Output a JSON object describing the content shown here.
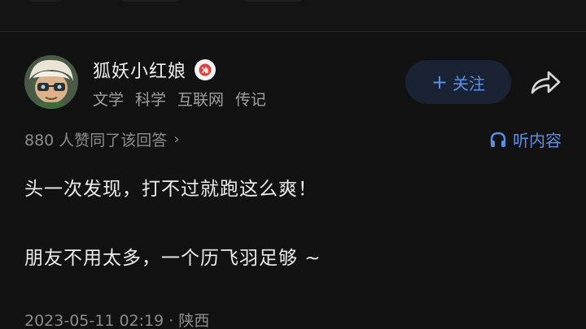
{
  "author": {
    "name": "狐妖小红娘",
    "tags": [
      "文学",
      "科学",
      "互联网",
      "传记"
    ],
    "badge_icon": "honor-badge-icon",
    "avatar_icon": "user-avatar"
  },
  "actions": {
    "follow_plus": "+",
    "follow_label": "关注",
    "share_icon": "share-arrow-icon"
  },
  "meta": {
    "vote_summary": "880 人赞同了该回答",
    "vote_chevron": "›",
    "listen_label": "听内容",
    "listen_icon": "headphones-icon"
  },
  "answer": {
    "paragraphs": [
      "头一次发现，打不过就跑这么爽！",
      "朋友不用太多，一个历飞羽足够 ~"
    ]
  },
  "post": {
    "time_location": "2023-05-11 02:19 · 陕西"
  },
  "colors": {
    "background": "#121212",
    "accent": "#5a8fe8",
    "text_primary": "#ececec",
    "text_secondary": "#8c8c8c",
    "badge_red": "#e0403a"
  }
}
